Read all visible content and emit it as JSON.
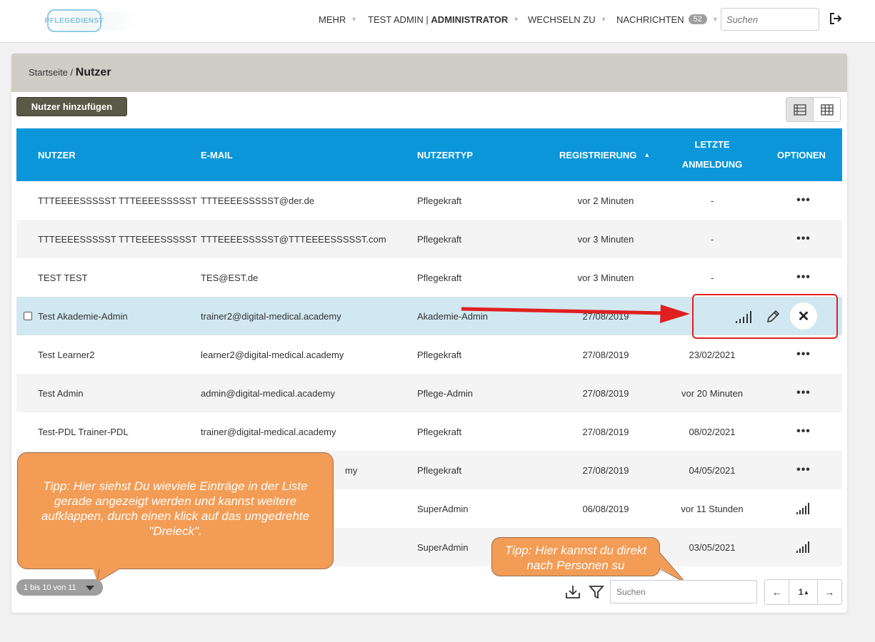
{
  "app": {
    "logo_text": "PFLEGEDIENST"
  },
  "nav": {
    "more": "MEHR",
    "user": "TEST ADMIN",
    "separator": "|",
    "role": "ADMINISTRATOR",
    "switch_to": "WECHSELN ZU",
    "messages": "NACHRICHTEN",
    "messages_count": "52",
    "search_placeholder": "Suchen"
  },
  "breadcrumb": {
    "home": "Startseite /",
    "current": "Nutzer"
  },
  "toolbar": {
    "add_user": "Nutzer hinzufügen"
  },
  "table": {
    "headers": {
      "user": "NUTZER",
      "email": "E-MAIL",
      "type": "NUTZERTYP",
      "registered": "REGISTRIERUNG",
      "last_login_1": "LETZTE",
      "last_login_2": "ANMELDUNG",
      "options": "OPTIONEN"
    },
    "rows": [
      {
        "name": "TTTEEEESSSSST TTTEEEESSSSST",
        "email": "TTTEEEESSSSST@der.de",
        "type": "Pflegekraft",
        "registered": "vor 2 Minuten",
        "last_login": "-",
        "options": "•••"
      },
      {
        "name": "TTTEEEESSSSST TTTEEEESSSSST",
        "email": "TTTEEEESSSSST@TTTEEEESSSSST.com",
        "type": "Pflegekraft",
        "registered": "vor 3 Minuten",
        "last_login": "-",
        "options": "•••"
      },
      {
        "name": "TEST TEST",
        "email": "TES@EST.de",
        "type": "Pflegekraft",
        "registered": "vor 3 Minuten",
        "last_login": "-",
        "options": "•••"
      },
      {
        "name": "Test Akademie-Admin",
        "email": "trainer2@digital-medical.academy",
        "type": "Akademie-Admin",
        "registered": "27/08/2019",
        "last_login": "",
        "options": ""
      },
      {
        "name": "Test Learner2",
        "email": "learner2@digital-medical.academy",
        "type": "Pflegekraft",
        "registered": "27/08/2019",
        "last_login": "23/02/2021",
        "options": "•••"
      },
      {
        "name": "Test Admin",
        "email": "admin@digital-medical.academy",
        "type": "Pflege-Admin",
        "registered": "27/08/2019",
        "last_login": "vor 20 Minuten",
        "options": "•••"
      },
      {
        "name": "Test-PDL Trainer-PDL",
        "email": "trainer@digital-medical.academy",
        "type": "Pflegekraft",
        "registered": "27/08/2019",
        "last_login": "08/02/2021",
        "options": "•••"
      },
      {
        "name": "",
        "email": "my",
        "type": "Pflegekraft",
        "registered": "27/08/2019",
        "last_login": "04/05/2021",
        "options": "•••"
      },
      {
        "name": "",
        "email": "",
        "type": "SuperAdmin",
        "registered": "06/08/2019",
        "last_login": "vor 11 Stunden",
        "options": ""
      },
      {
        "name": "",
        "email": "",
        "type": "SuperAdmin",
        "registered": "",
        "last_login": "03/05/2021",
        "options": ""
      }
    ]
  },
  "tips": {
    "tip1": "Tipp: Hier siehst Du wieviele Einträge in der Liste gerade angezeigt werden und kannst weitere aufklappen, durch einen klick auf das umgedrehte \"Dreieck\".",
    "tip2": "Tipp: Hier kannst du direkt nach Personen su"
  },
  "footer": {
    "range": "1 bis 10 von 11",
    "search_placeholder": "Suchen",
    "page": "1",
    "page_caret": "▴",
    "prev": "←",
    "next": "→"
  },
  "colors": {
    "header_blue": "#0a96d9",
    "highlight_row": "#d1e8f1",
    "tip_orange": "#f39c56",
    "annotation_red": "#e32020"
  }
}
